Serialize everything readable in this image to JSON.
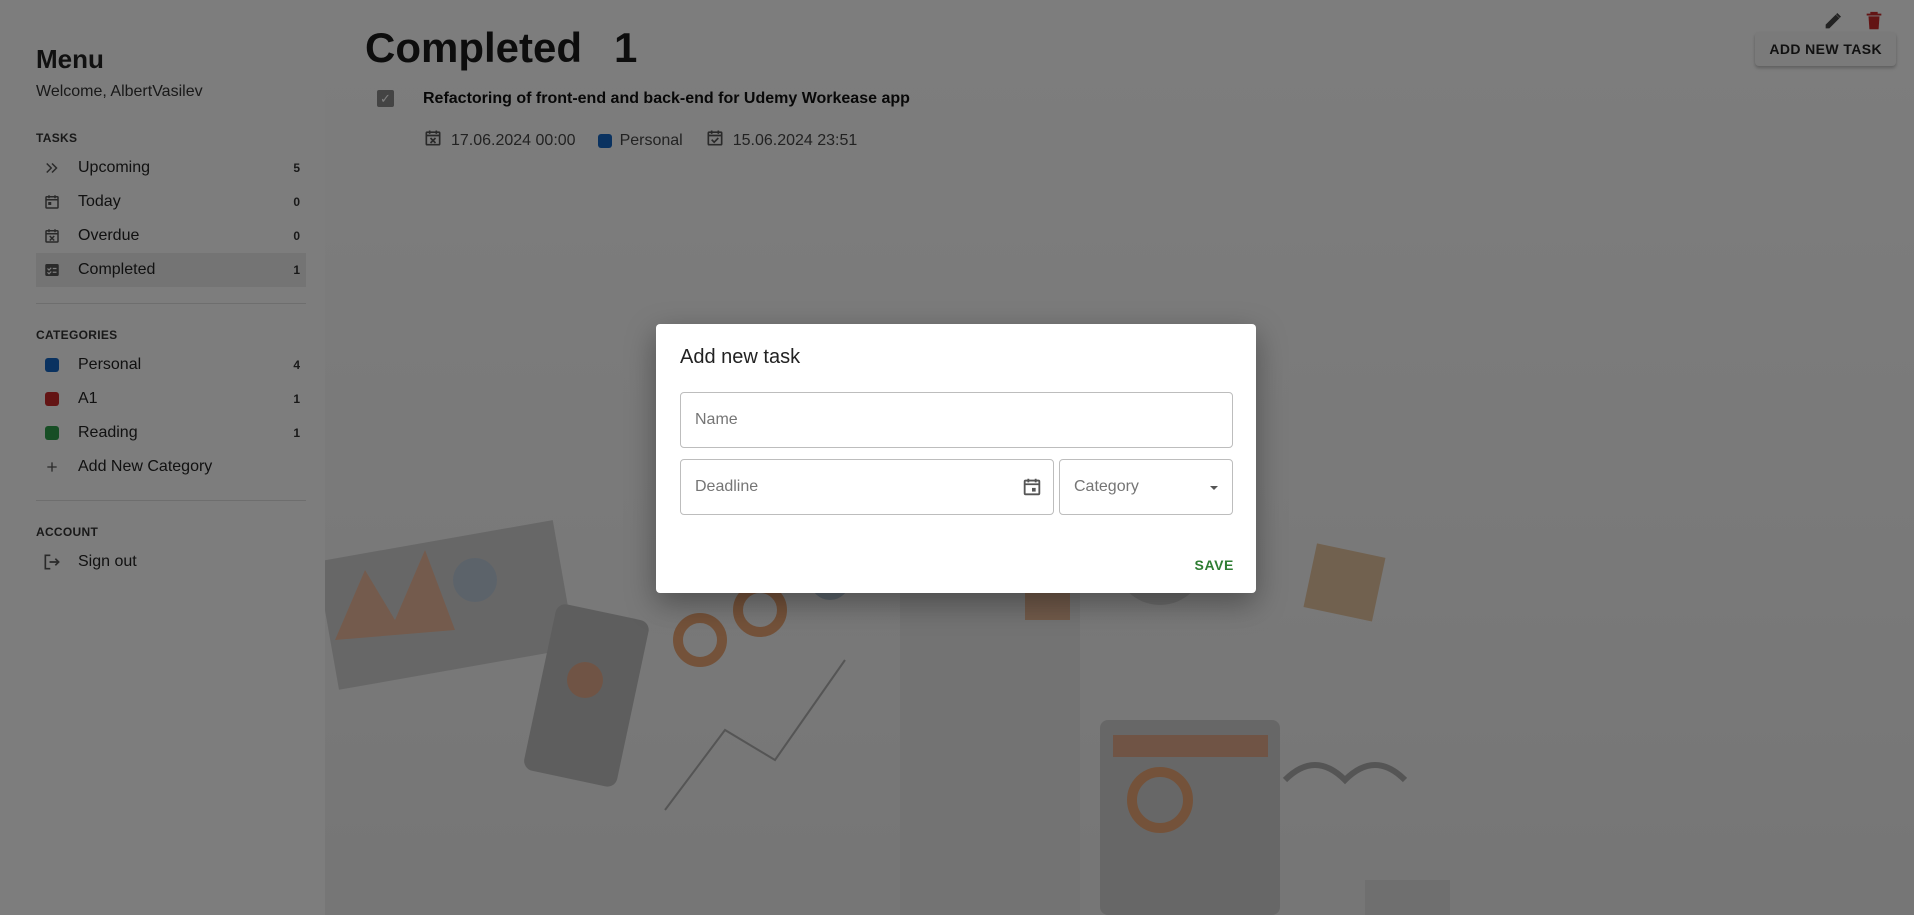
{
  "sidebar": {
    "title": "Menu",
    "welcome": "Welcome, AlbertVasilev",
    "tasks_section": "TASKS",
    "tasks": [
      {
        "label": "Upcoming",
        "count": "5",
        "icon": "double-chevron-right-icon"
      },
      {
        "label": "Today",
        "count": "0",
        "icon": "calendar-today-icon"
      },
      {
        "label": "Overdue",
        "count": "0",
        "icon": "calendar-x-icon"
      },
      {
        "label": "Completed",
        "count": "1",
        "icon": "checklist-icon"
      }
    ],
    "categories_section": "CATEGORIES",
    "categories": [
      {
        "label": "Personal",
        "count": "4",
        "color": "#1565c0"
      },
      {
        "label": "A1",
        "count": "1",
        "color": "#c62828"
      },
      {
        "label": "Reading",
        "count": "1",
        "color": "#2e9d4a"
      }
    ],
    "add_category": "Add New Category",
    "account_section": "ACCOUNT",
    "sign_out": "Sign out"
  },
  "main": {
    "title": "Completed",
    "count": "1",
    "add_task_label": "ADD NEW TASK",
    "task": {
      "title": "Refactoring of front-end and back-end for Udemy Workease app",
      "deadline": "17.06.2024 00:00",
      "category": "Personal",
      "category_color": "#1565c0",
      "completed_at": "15.06.2024 23:51"
    }
  },
  "dialog": {
    "title": "Add new task",
    "name_placeholder": "Name",
    "deadline_placeholder": "Deadline",
    "category_placeholder": "Category",
    "save_label": "SAVE"
  },
  "colors": {
    "accent_green": "#2e7d32",
    "delete_red": "#c62828"
  }
}
